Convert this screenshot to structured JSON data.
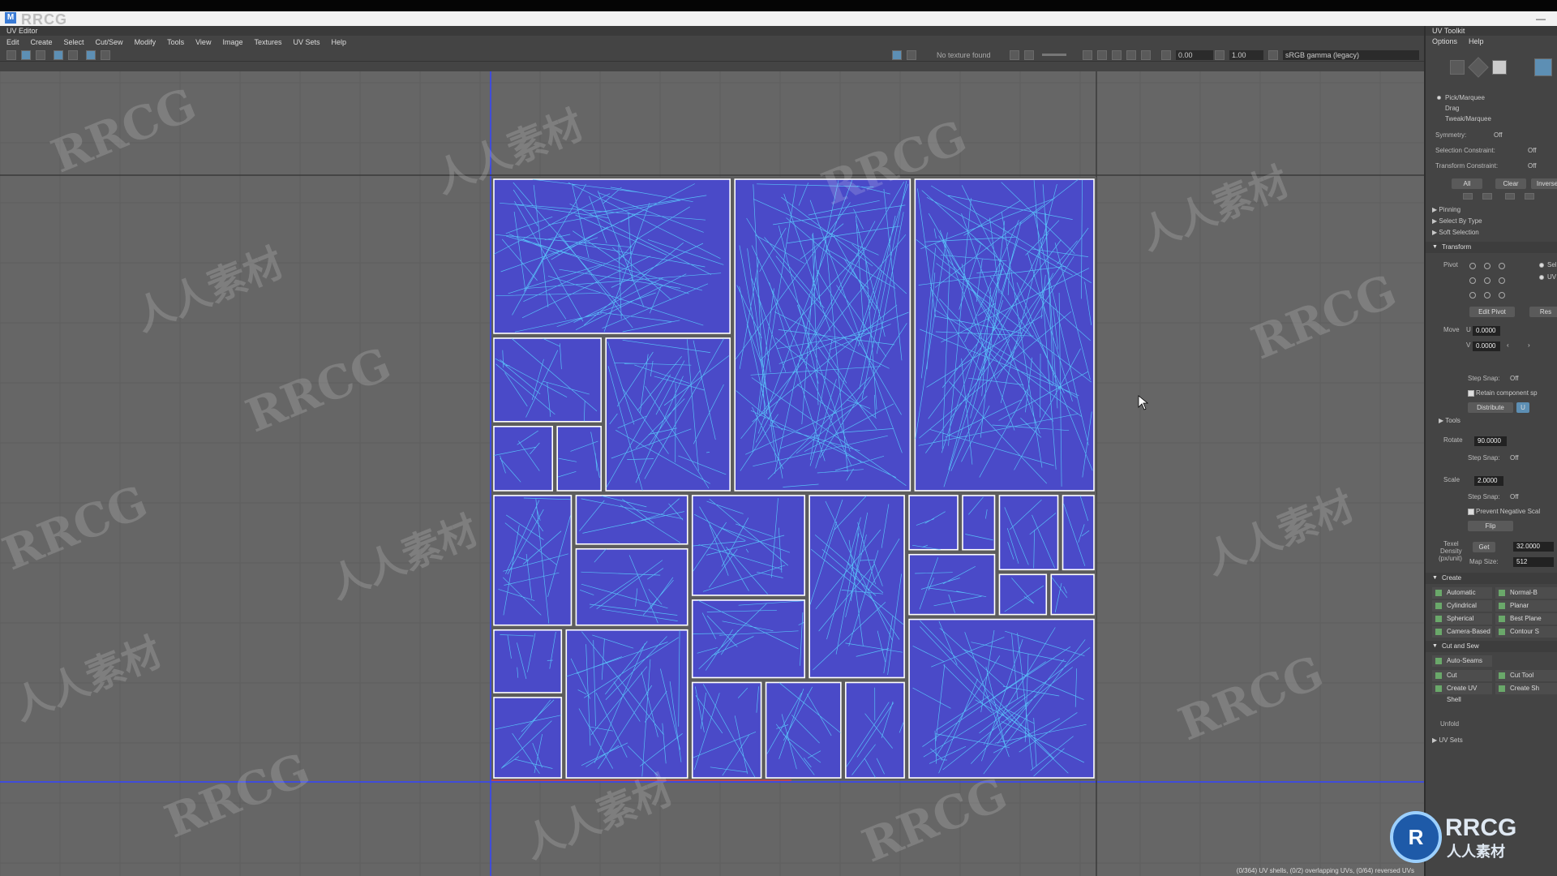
{
  "app": {
    "watermark_top": "RRCG",
    "editor_title": "UV Editor",
    "toolkit_title": "UV Toolkit"
  },
  "menu": [
    "Edit",
    "Create",
    "Select",
    "Cut/Sew",
    "Modify",
    "Tools",
    "View",
    "Image",
    "Textures",
    "UV Sets",
    "Help"
  ],
  "toolbar": {
    "texture_status": "No texture found",
    "exposure": "0.00",
    "gamma": "1.00",
    "color_space": "sRGB gamma (legacy)"
  },
  "viewport": {
    "watermarks": [
      "RRCG",
      "人人素材"
    ],
    "status": "(0/364) UV shells, (0/2) overlapping UVs, (0/64) reversed UVs"
  },
  "toolkit": {
    "menu": [
      "Options",
      "Help"
    ],
    "modes": [
      "Pick/Marquee",
      "Drag",
      "Tweak/Marquee"
    ],
    "symmetry_label": "Symmetry:",
    "symmetry_value": "Off",
    "selection_constraint_label": "Selection Constraint:",
    "selection_constraint_value": "Off",
    "transform_constraint_label": "Transform Constraint:",
    "transform_constraint_value": "Off",
    "select_buttons": [
      "All",
      "Clear",
      "Inverse"
    ],
    "sections_collapsed": [
      "Pinning",
      "Select By Type",
      "Soft Selection"
    ],
    "transform_header": "Transform",
    "pivot_label": "Pivot",
    "pivot_options": [
      "Sel",
      "UV"
    ],
    "edit_pivot": "Edit Pivot",
    "reset": "Res",
    "move_label": "Move",
    "u_label": "U",
    "v_label": "V",
    "move_u": "0.0000",
    "move_v": "0.0000",
    "step_snap_label": "Step Snap:",
    "step_snap_value": "Off",
    "retain_label": "Retain component sp",
    "distribute_label": "Distribute",
    "distribute_btn": "U",
    "tools_header": "Tools",
    "rotate_label": "Rotate",
    "rotate_value": "90.0000",
    "scale_label": "Scale",
    "scale_value": "2.0000",
    "prevent_label": "Prevent Negative Scal",
    "flip_label": "Flip",
    "texel_label_1": "Texel",
    "texel_label_2": "Density",
    "texel_label_3": "(px/unit)",
    "get_btn": "Get",
    "texel_value": "32.0000",
    "map_size_label": "Map Size:",
    "map_size_value": "512",
    "create_header": "Create",
    "create_items": [
      "Automatic",
      "Normal-B",
      "Cylindrical",
      "Planar",
      "Spherical",
      "Best Plane",
      "Camera-Based",
      "Contour S"
    ],
    "cut_sew_header": "Cut and Sew",
    "auto_seams": "Auto-Seams",
    "cut_items": [
      "Cut",
      "Cut Tool",
      "Create UV Shell",
      "Create Sh"
    ],
    "unfold_label": "Unfold",
    "uv_sets_header": "UV Sets"
  },
  "badge": {
    "brand": "RRCG",
    "sub": "人人素材"
  },
  "colors": {
    "viewport_bg": "#666666",
    "uv_fill": "#4a4ac8",
    "uv_wire": "#5ad2ff",
    "uv_border": "#ffffff",
    "axis_line": "#3344ff"
  }
}
